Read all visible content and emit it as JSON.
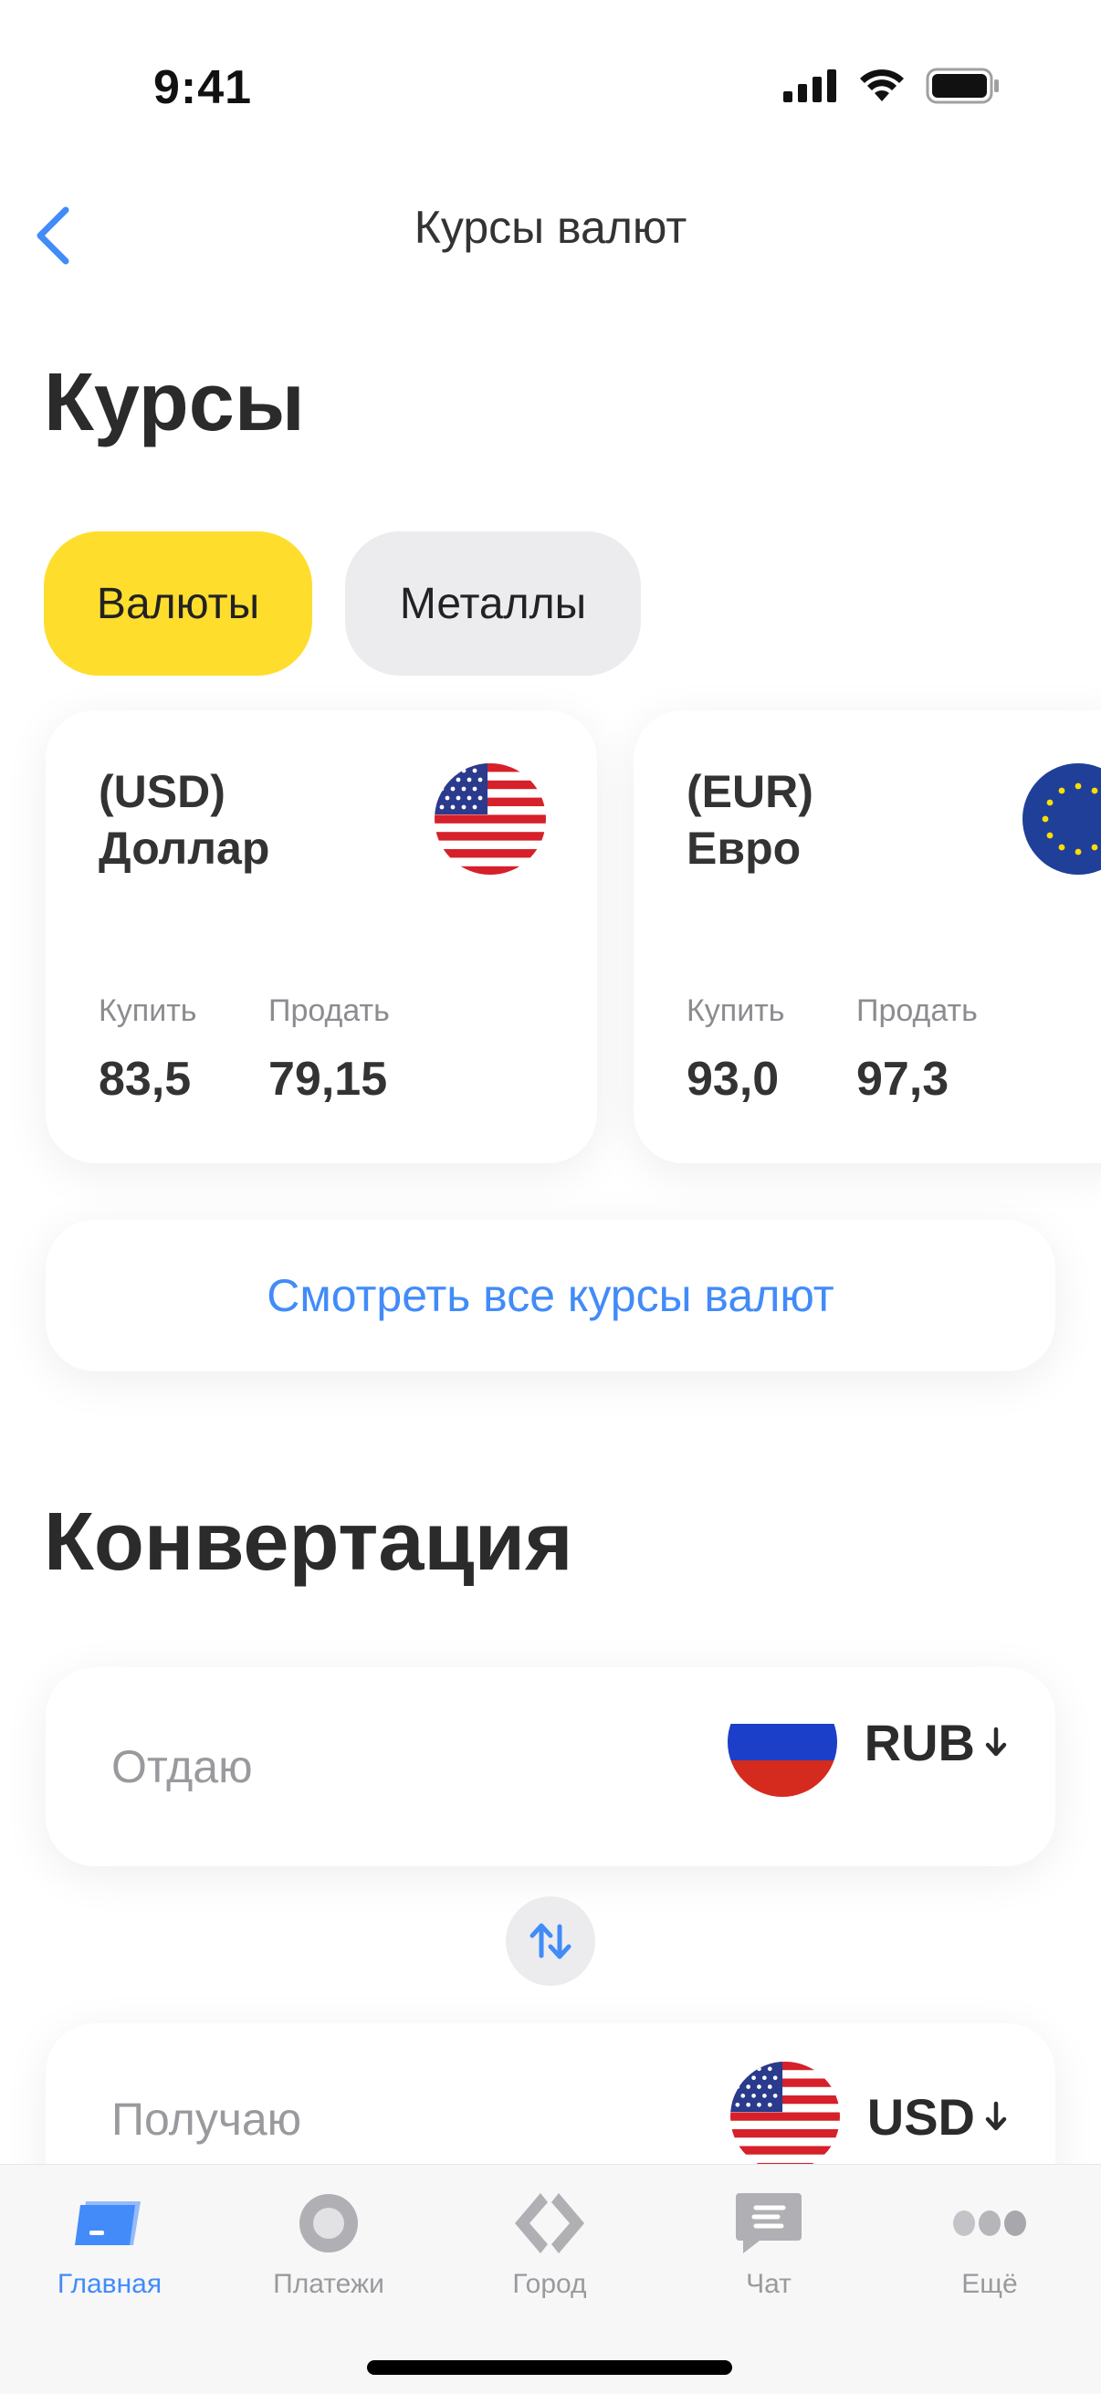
{
  "status_bar": {
    "time": "9:41"
  },
  "nav": {
    "title": "Курсы валют",
    "back_icon": "chevron-left-icon"
  },
  "rates_section": {
    "title": "Курсы",
    "tabs": [
      {
        "label": "Валюты",
        "active": true
      },
      {
        "label": "Металлы",
        "active": false
      }
    ],
    "cards": [
      {
        "code": "(USD)",
        "name": "Доллар",
        "flag": "us-flag-icon",
        "buy_label": "Купить",
        "buy": "83,5",
        "sell_label": "Продать",
        "sell": "79,15"
      },
      {
        "code": "(EUR)",
        "name": "Евро",
        "flag": "eu-flag-icon",
        "buy_label": "Купить",
        "buy": "93,0",
        "sell_label": "Продать",
        "sell": "97,3"
      }
    ],
    "all_rates_link": "Смотреть все курсы валют"
  },
  "conversion": {
    "title": "Конвертация",
    "give": {
      "label": "Отдаю",
      "currency": "RUB",
      "flag": "ru-flag-icon"
    },
    "get": {
      "label": "Получаю",
      "currency": "USD",
      "flag": "us-flag-icon"
    },
    "swap_icon": "swap-arrows-icon"
  },
  "tab_bar": {
    "items": [
      {
        "label": "Главная",
        "icon": "home-card-icon",
        "active": true
      },
      {
        "label": "Платежи",
        "icon": "payments-circle-icon",
        "active": false
      },
      {
        "label": "Город",
        "icon": "city-icon",
        "active": false
      },
      {
        "label": "Чат",
        "icon": "chat-icon",
        "active": false
      },
      {
        "label": "Ещё",
        "icon": "more-dots-icon",
        "active": false
      }
    ]
  },
  "colors": {
    "accent": "#428bf9",
    "tab_active": "#ffdd2d",
    "tab_inactive": "#ececee",
    "text": "#2b2b2b",
    "muted": "#9a9a9e"
  }
}
